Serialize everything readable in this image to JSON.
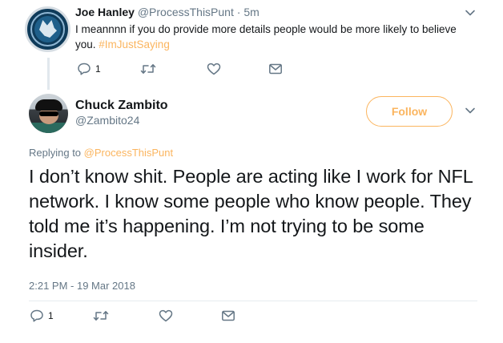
{
  "reply_tweet": {
    "author_name": "Joe Hanley",
    "author_handle": "@ProcessThisPunt",
    "separator": " · ",
    "age": "5m",
    "text": "I meannnn if you do provide more details people would be more likely to believe you. ",
    "hashtag": "#ImJustSaying",
    "reply_count": "1"
  },
  "main_tweet": {
    "author_name": "Chuck Zambito",
    "author_handle": "@Zambito24",
    "follow_label": "Follow",
    "replying_prefix": "Replying to ",
    "replying_handle": "@ProcessThisPunt",
    "text": "I don’t know shit. People are acting like I work for NFL network. I know some people who know people. They told me it’s happening. I’m not trying to be some insider.",
    "timestamp": "2:21 PM - 19 Mar 2018",
    "reply_count": "1"
  },
  "icons": {
    "reply": "reply-icon",
    "retweet": "retweet-icon",
    "like": "heart-icon",
    "dm": "envelope-icon",
    "more": "chevron-down-icon"
  },
  "colors": {
    "accent": "#fbb55f",
    "secondary_text": "#657786",
    "primary_text": "#14171a"
  }
}
